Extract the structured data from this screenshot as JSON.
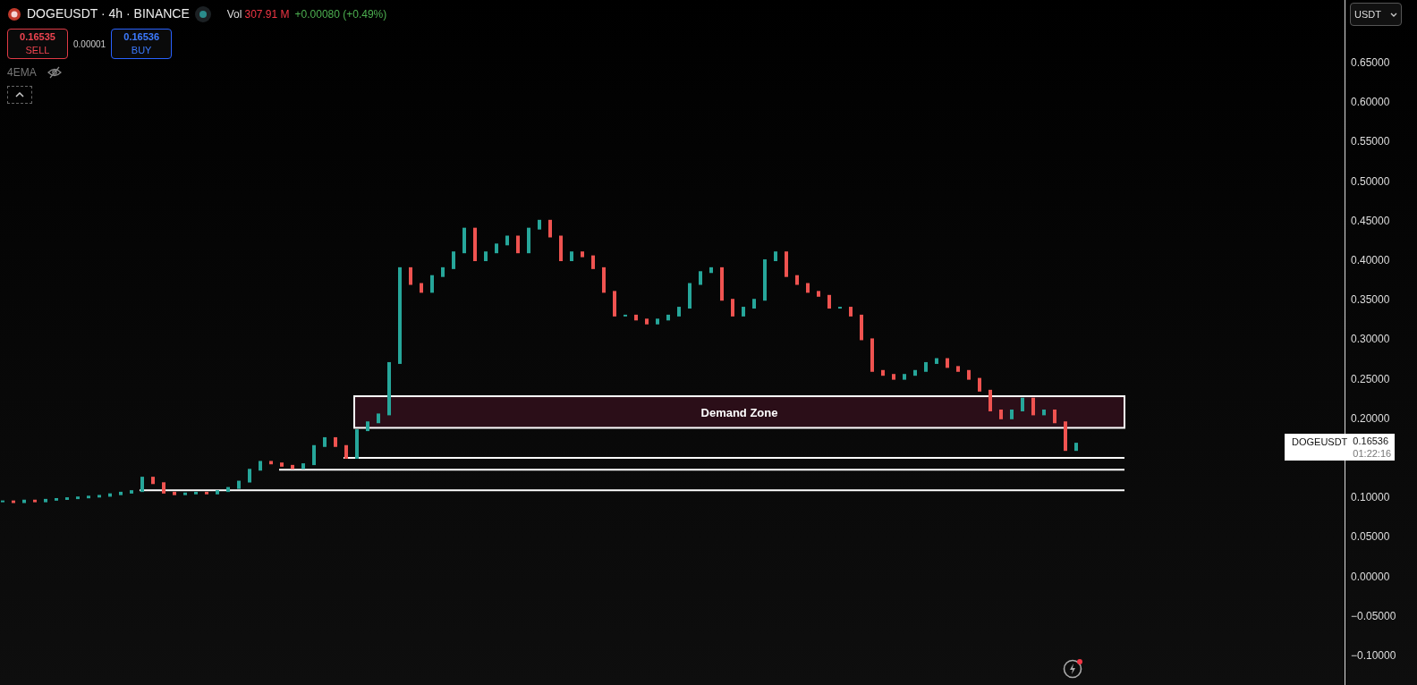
{
  "header": {
    "symbol": "DOGEUSDT · 4h · BINANCE",
    "volume_label": "Vol",
    "volume": "307.91 M",
    "change": "+0.00080 (+0.49%)"
  },
  "trade": {
    "sell_price": "0.16535",
    "sell_label": "SELL",
    "spread": "0.00001",
    "buy_price": "0.16536",
    "buy_label": "BUY"
  },
  "indicator": {
    "name": "4EMA",
    "visible": false
  },
  "currency": "USDT",
  "price_tag": {
    "symbol": "DOGEUSDT",
    "price": "0.16536",
    "countdown": "01:22:16"
  },
  "drawings": [
    {
      "kind": "zone",
      "label": "Demand Zone"
    },
    {
      "kind": "level"
    },
    {
      "kind": "level"
    },
    {
      "kind": "level"
    }
  ],
  "price_axis": [
    "0.65000",
    "0.60000",
    "0.55000",
    "0.50000",
    "0.45000",
    "0.40000",
    "0.35000",
    "0.30000",
    "0.25000",
    "0.20000",
    "0.10000",
    "0.05000",
    "0.00000",
    "−0.05000",
    "−0.10000"
  ]
}
